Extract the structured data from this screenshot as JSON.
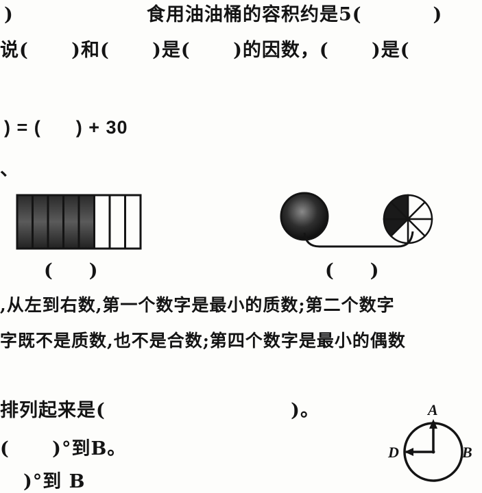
{
  "lines": {
    "l1_left": ")",
    "l1_right": "食用油油桶的容积约是5(          )",
    "l2": "说(      )和(      )是(      )的因数，(      )是(",
    "l3": ") = (      ) + 30",
    "l4": "、",
    "paren_rect": "(     )",
    "paren_circles": "(     )",
    "l5": ",从左到右数,第一个数字是最小的质数;第二个数字",
    "l6": "字既不是质数,也不是合数;第四个数字是最小的偶数",
    "l7": "排列起来是(                          )。",
    "l8": "(      )°到B。",
    "l9": ")°到 B"
  },
  "figure_labels": {
    "a": "A",
    "b": "B",
    "d": "D"
  },
  "fraction_bar": {
    "total_parts": 8,
    "shaded_parts": 5
  },
  "fraction_circles": [
    {
      "total_parts": 8,
      "shaded_parts": 8
    },
    {
      "total_parts": 8,
      "shaded_parts": 3
    }
  ],
  "colors": {
    "ink": "#141414",
    "paper": "#fdfdfb"
  }
}
